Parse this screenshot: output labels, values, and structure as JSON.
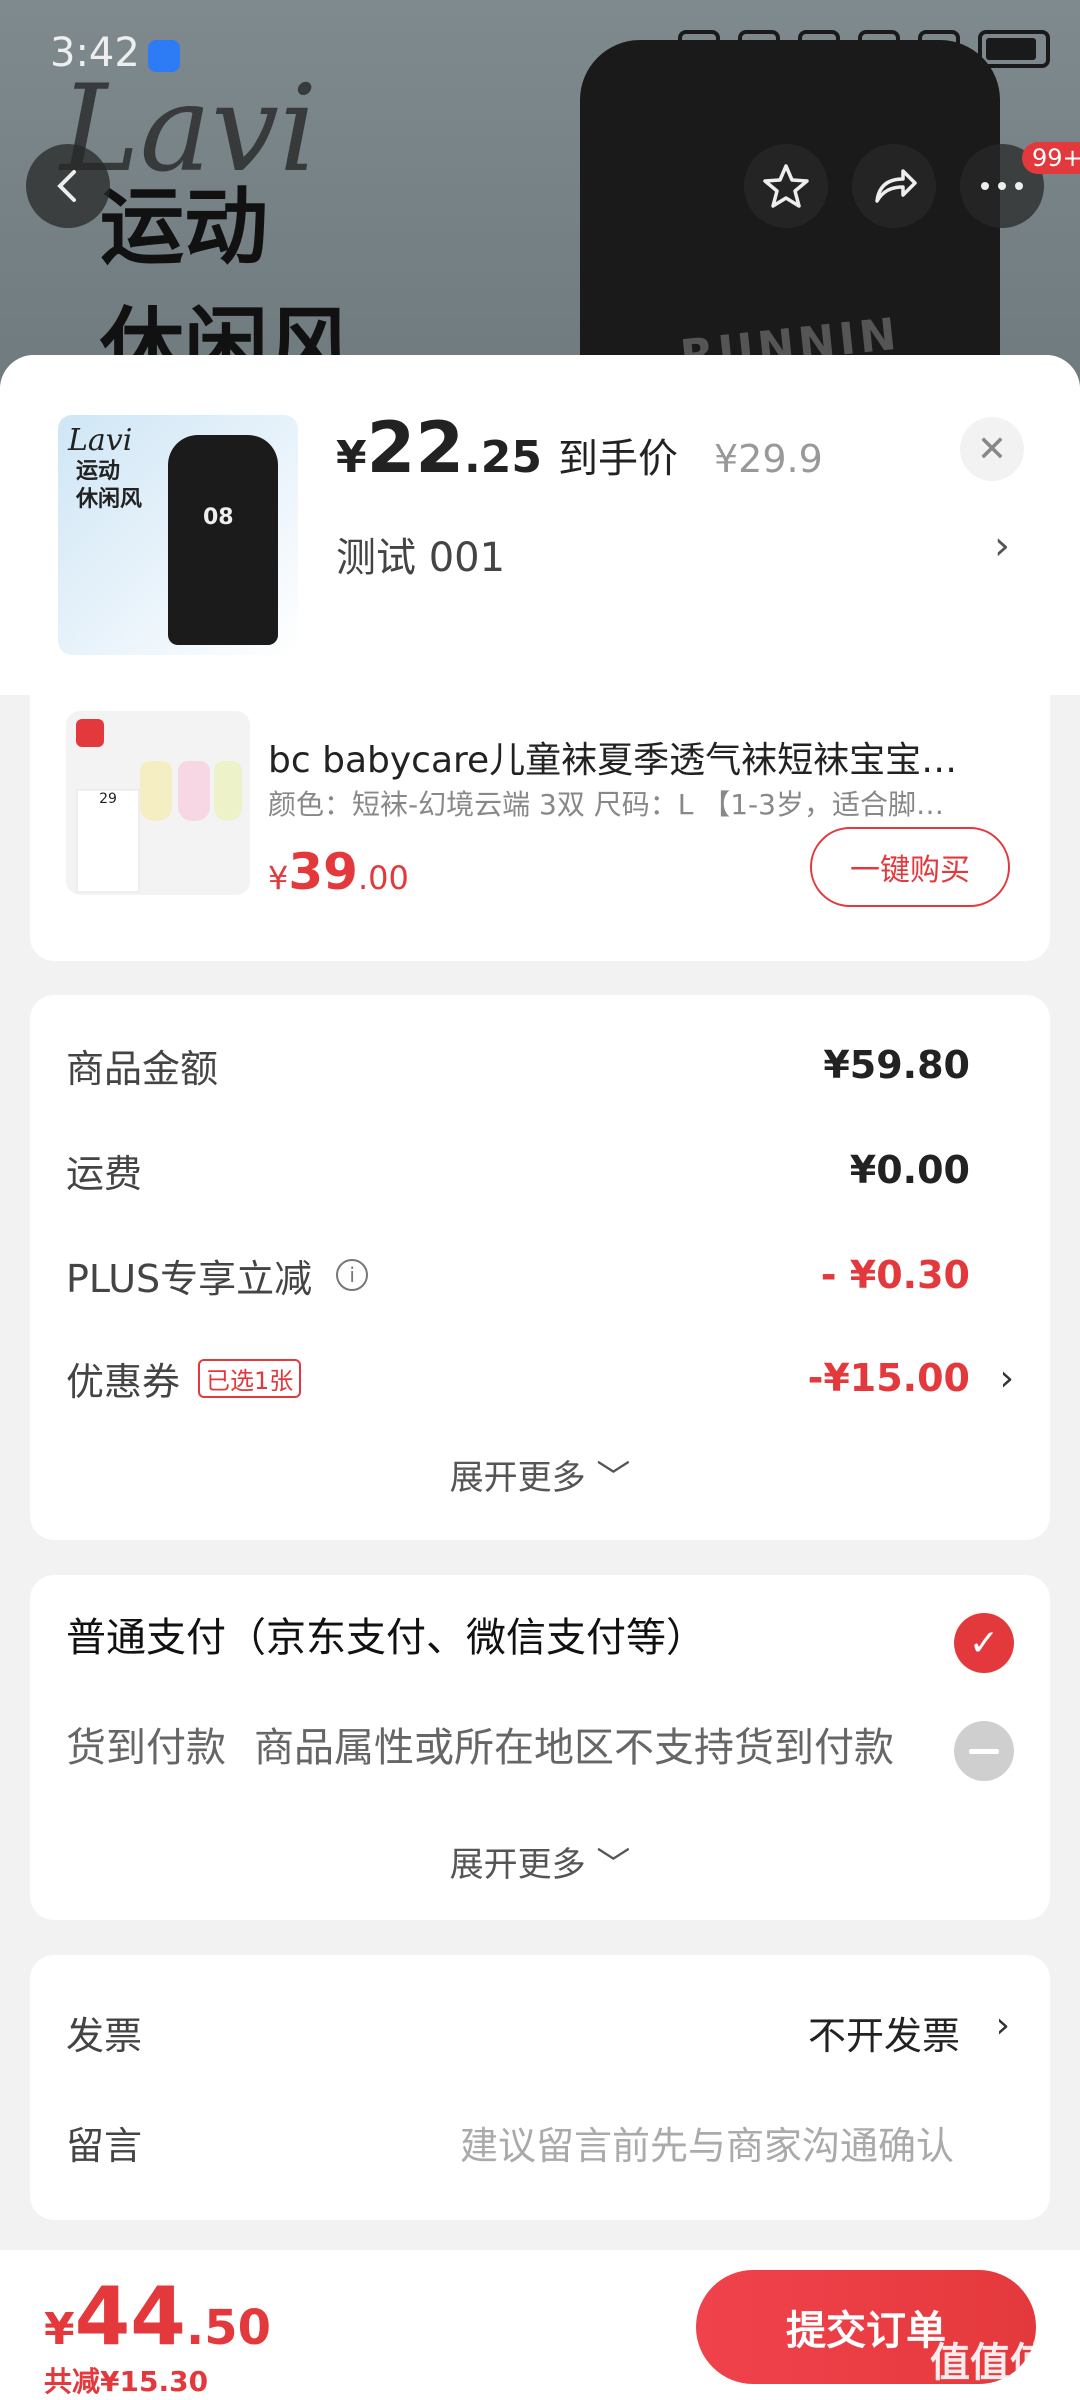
{
  "status_bar": {
    "time": "3:42"
  },
  "background": {
    "brand": "Lavi",
    "slogan_1": "运动",
    "slogan_2": "休闲风",
    "pants_text": "RUNNIN"
  },
  "nav": {
    "badge": "99+"
  },
  "product": {
    "thumb": {
      "brand": "Lavi",
      "line1": "运动",
      "line2": "休闲风",
      "number": "08"
    },
    "price_yen": "¥",
    "price_int": "22",
    "price_dec": ".25",
    "price_label": "到手价",
    "original_price": "¥29.9",
    "spec": "测试  001"
  },
  "recommend": {
    "title": "bc babycare儿童袜夏季透气袜短袜宝宝…",
    "spec": "颜色：短袜-幻境云端 3双   尺码：L 【1-3岁，适合脚…",
    "price_yen": "¥",
    "price_int": "39",
    "price_dec": ".00",
    "buy_label": "一键购买",
    "tag_price": "29"
  },
  "amounts": {
    "rows": [
      {
        "label": "商品金额",
        "value": "¥59.80"
      },
      {
        "label": "运费",
        "value": "¥0.00"
      },
      {
        "label": "PLUS专享立减",
        "value": "- ¥0.30"
      },
      {
        "label": "优惠券",
        "tag": "已选1张",
        "value": "-¥15.00"
      }
    ],
    "more_label": "展开更多 ﹀"
  },
  "payment": {
    "normal": "普通支付（京东支付、微信支付等）",
    "cod_label": "货到付款",
    "cod_desc": "商品属性或所在地区不支持货到付款",
    "more_label": "展开更多 ﹀"
  },
  "invoice": {
    "label": "发票",
    "value": "不开发票",
    "note_label": "留言",
    "note_placeholder": "建议留言前先与商家沟通确认"
  },
  "bottom": {
    "total_yen": "¥",
    "total_int": "44",
    "total_dec": ".50",
    "saved": "共减¥15.30",
    "submit_label": "提交订单"
  },
  "watermark": "值值值",
  "colors": {
    "accent": "#e4393c",
    "background": "#f2f2f2"
  }
}
